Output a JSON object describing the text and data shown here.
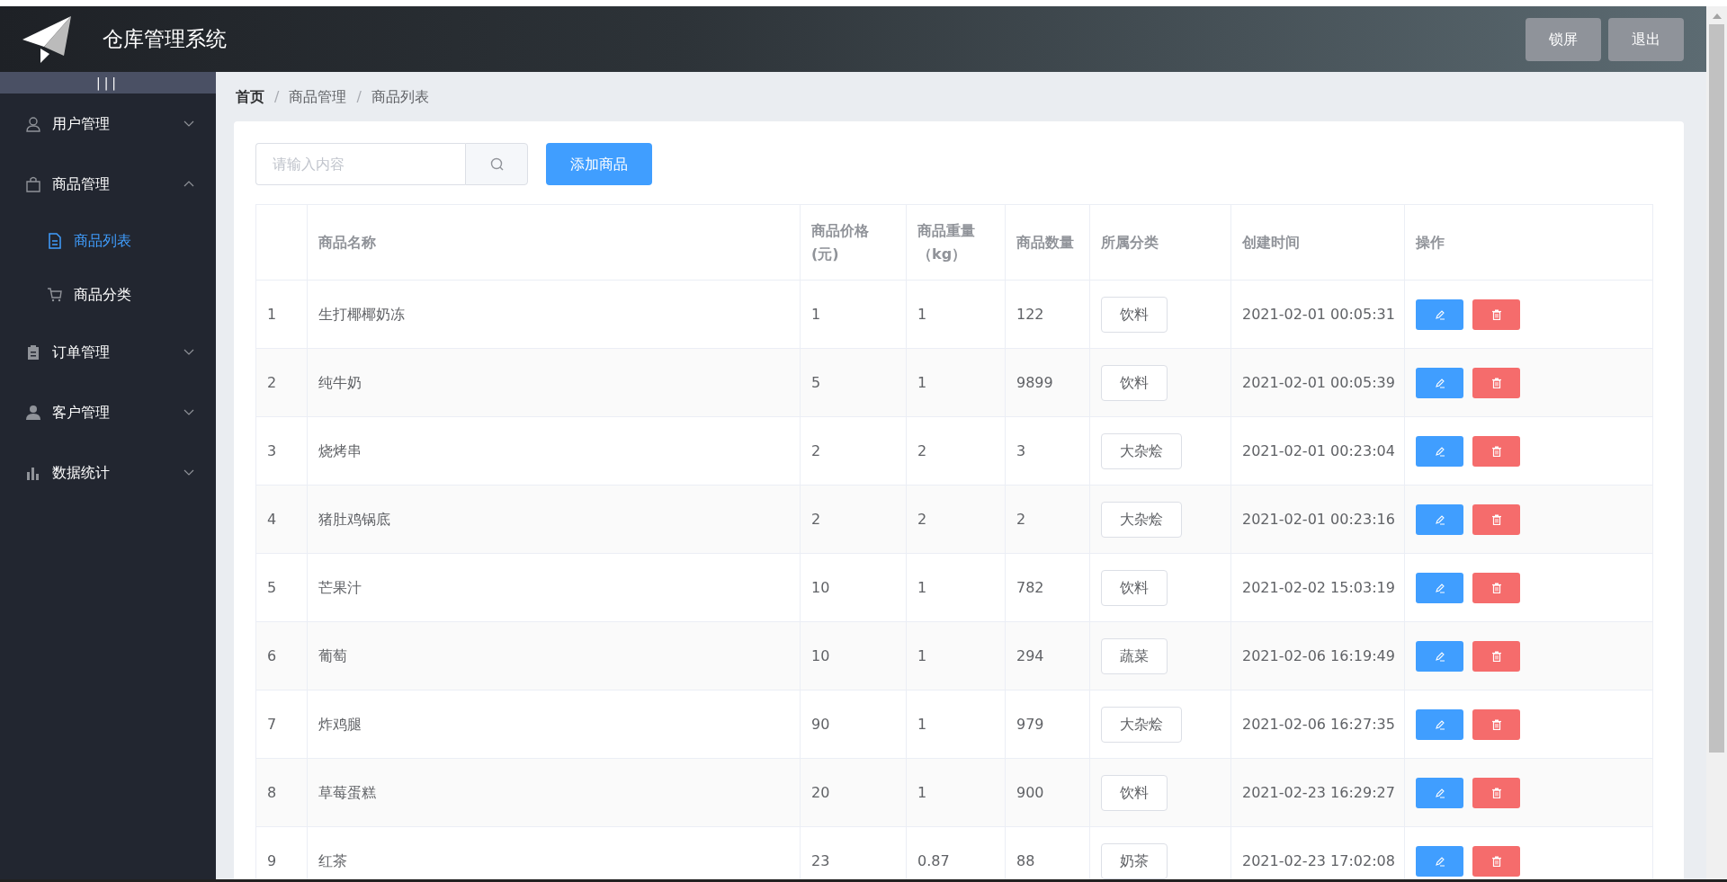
{
  "header": {
    "title": "仓库管理系统",
    "buttons": [
      "锁屏",
      "退出"
    ]
  },
  "sidebar": {
    "toggle": "|||",
    "items": [
      {
        "label": "用户管理",
        "expanded": false
      },
      {
        "label": "商品管理",
        "expanded": true,
        "children": [
          {
            "label": "商品列表",
            "selected": true
          },
          {
            "label": "商品分类",
            "selected": false
          }
        ]
      },
      {
        "label": "订单管理",
        "expanded": false
      },
      {
        "label": "客户管理",
        "expanded": false
      },
      {
        "label": "数据统计",
        "expanded": false
      }
    ]
  },
  "breadcrumb": [
    {
      "label": "首页",
      "bold": true
    },
    {
      "separator": "/",
      "label": "商品管理",
      "bold": false
    },
    {
      "separator": "/",
      "label": "商品列表",
      "bold": false
    }
  ],
  "search": {
    "placeholder": "请输入内容"
  },
  "add_button": "添加商品",
  "table": {
    "columns": [
      "",
      "商品名称",
      "商品价格(元)",
      "商品重量（kg）",
      "商品数量",
      "所属分类",
      "创建时间",
      "操作"
    ],
    "rows": [
      {
        "index": "1",
        "name": "生打椰椰奶冻",
        "price": "1",
        "weight": "1",
        "quantity": "122",
        "category": "饮料",
        "created": "2021-02-01 00:05:31"
      },
      {
        "index": "2",
        "name": "纯牛奶",
        "price": "5",
        "weight": "1",
        "quantity": "9899",
        "category": "饮料",
        "created": "2021-02-01 00:05:39"
      },
      {
        "index": "3",
        "name": "烧烤串",
        "price": "2",
        "weight": "2",
        "quantity": "3",
        "category": "大杂烩",
        "created": "2021-02-01 00:23:04"
      },
      {
        "index": "4",
        "name": "猪肚鸡锅底",
        "price": "2",
        "weight": "2",
        "quantity": "2",
        "category": "大杂烩",
        "created": "2021-02-01 00:23:16"
      },
      {
        "index": "5",
        "name": "芒果汁",
        "price": "10",
        "weight": "1",
        "quantity": "782",
        "category": "饮料",
        "created": "2021-02-02 15:03:19"
      },
      {
        "index": "6",
        "name": "葡萄",
        "price": "10",
        "weight": "1",
        "quantity": "294",
        "category": "蔬菜",
        "created": "2021-02-06 16:19:49"
      },
      {
        "index": "7",
        "name": "炸鸡腿",
        "price": "90",
        "weight": "1",
        "quantity": "979",
        "category": "大杂烩",
        "created": "2021-02-06 16:27:35"
      },
      {
        "index": "8",
        "name": "草莓蛋糕",
        "price": "20",
        "weight": "1",
        "quantity": "900",
        "category": "饮料",
        "created": "2021-02-23 16:29:27"
      },
      {
        "index": "9",
        "name": "红茶",
        "price": "23",
        "weight": "0.87",
        "quantity": "88",
        "category": "奶茶",
        "created": "2021-02-23 17:02:08"
      }
    ]
  }
}
